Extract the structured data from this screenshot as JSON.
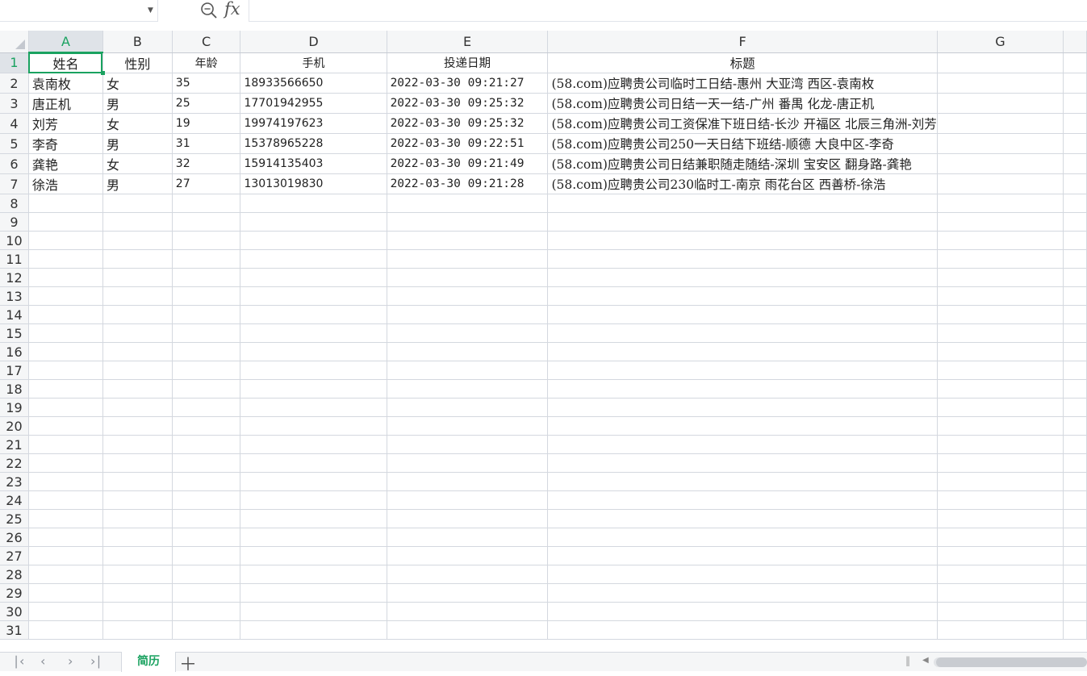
{
  "formula_bar": {
    "name_box_value": "",
    "formula_value": "",
    "fx_label": "fx"
  },
  "columns": [
    "A",
    "B",
    "C",
    "D",
    "E",
    "F",
    "G"
  ],
  "header_row": [
    "姓名",
    "性别",
    "年龄",
    "手机",
    "投递日期",
    "标题",
    ""
  ],
  "rows": [
    [
      "袁南枚",
      "女",
      "35",
      "18933566650",
      "2022-03-30 09:21:27",
      "(58.com)应聘贵公司临时工日结-惠州 大亚湾 西区-袁南枚",
      ""
    ],
    [
      "唐正机",
      "男",
      "25",
      "17701942955",
      "2022-03-30 09:25:32",
      "(58.com)应聘贵公司日结一天一结-广州 番禺 化龙-唐正机",
      ""
    ],
    [
      "刘芳",
      "女",
      "19",
      "19974197623",
      "2022-03-30 09:25:32",
      "(58.com)应聘贵公司工资保准下班日结-长沙 开福区 北辰三角洲-刘芳",
      ""
    ],
    [
      "李奇",
      "男",
      "31",
      "15378965228",
      "2022-03-30 09:22:51",
      "(58.com)应聘贵公司250一天日结下班结-顺德 大良中区-李奇",
      ""
    ],
    [
      "龚艳",
      "女",
      "32",
      "15914135403",
      "2022-03-30 09:21:49",
      "(58.com)应聘贵公司日结兼职随走随结-深圳 宝安区 翻身路-龚艳",
      ""
    ],
    [
      "徐浩",
      "男",
      "27",
      "13013019830",
      "2022-03-30 09:21:28",
      "(58.com)应聘贵公司230临时工-南京 雨花台区 西善桥-徐浩",
      ""
    ]
  ],
  "row_numbers": [
    "1",
    "2",
    "3",
    "4",
    "5",
    "6",
    "7",
    "8",
    "9",
    "10",
    "11",
    "12",
    "13",
    "14",
    "15",
    "16",
    "17",
    "18",
    "19",
    "20",
    "21",
    "22",
    "23",
    "24",
    "25",
    "26",
    "27",
    "28",
    "29",
    "30",
    "31"
  ],
  "sheet_tabs": [
    {
      "label": "简历",
      "active": true
    }
  ],
  "nav": {
    "first": "|<",
    "prev": "<",
    "next": ">",
    "last": ">|",
    "add": "+"
  },
  "accent_color": "#1aa260"
}
